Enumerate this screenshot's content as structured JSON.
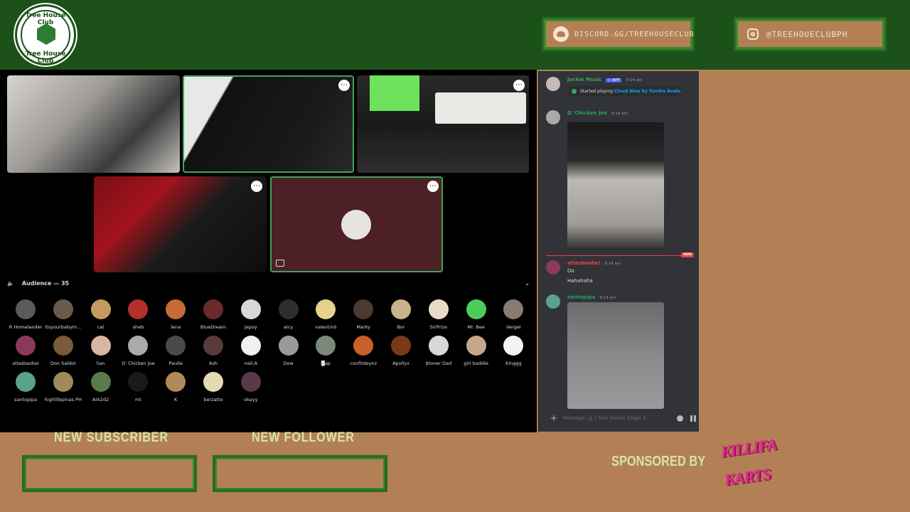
{
  "header": {
    "logo_text_top": "Tree House Club",
    "logo_text_bottom": "Tree House Club",
    "discord_label": "DISCORD.GG/TREEHOUSECLUB",
    "instagram_label": "@TREEHOUECLUBPH"
  },
  "audience": {
    "title": "Audience — 35",
    "members": [
      {
        "name": "R Homelander",
        "color": "#5a5a5a"
      },
      {
        "name": "Itsyourbabym...",
        "color": "#6b5a4a"
      },
      {
        "name": "cat",
        "color": "#c59b5d"
      },
      {
        "name": "sheb",
        "color": "#b1302c"
      },
      {
        "name": "lena",
        "color": "#c66a38"
      },
      {
        "name": "BlueDream",
        "color": "#6b2a2a"
      },
      {
        "name": "Jepoy",
        "color": "#d7d7d7"
      },
      {
        "name": "aicy",
        "color": "#2e2e2e"
      },
      {
        "name": "valentinö",
        "color": "#e7d18c"
      },
      {
        "name": "Marky",
        "color": "#4a3a30"
      },
      {
        "name": "Bor",
        "color": "#c7b48a"
      },
      {
        "name": "SirPrize",
        "color": "#e8dac8"
      },
      {
        "name": "Mr. Bee",
        "color": "#4ccf5a"
      },
      {
        "name": "Vergel",
        "color": "#8a7a70"
      },
      {
        "name": "atlasbaobei",
        "color": "#8a3a5c"
      },
      {
        "name": "Don Saldot",
        "color": "#7a5a3a"
      },
      {
        "name": "lian",
        "color": "#d9b6a0"
      },
      {
        "name": "D' Chicken Joe",
        "color": "#aaaaaa"
      },
      {
        "name": "Paulie",
        "color": "#4a4a4a"
      },
      {
        "name": "Ash",
        "color": "#5a3a3a"
      },
      {
        "name": "neil.A",
        "color": "#f0f0f0"
      },
      {
        "name": "Dew",
        "color": "#9a9a9a"
      },
      {
        "name": "█ap",
        "color": "#7a8a7a"
      },
      {
        "name": "confitdeynz",
        "color": "#c9602a"
      },
      {
        "name": "Apollyx",
        "color": "#7a3a1a"
      },
      {
        "name": "$toner Dad",
        "color": "#d8d8d8"
      },
      {
        "name": "girl baddie",
        "color": "#c4a68a"
      },
      {
        "name": "Kinggg",
        "color": "#f4f4f4"
      },
      {
        "name": "santopipa",
        "color": "#5aa38a"
      },
      {
        "name": "highlifepinas PH",
        "color": "#a08a5a"
      },
      {
        "name": "Ark2d2",
        "color": "#5a7a4a"
      },
      {
        "name": "mt",
        "color": "#1a1a1a"
      },
      {
        "name": "K",
        "color": "#b08a5a"
      },
      {
        "name": "berzatto",
        "color": "#e6d8b0"
      },
      {
        "name": "okayy",
        "color": "#5a3a4a"
      }
    ]
  },
  "chat": {
    "messages": [
      {
        "name": "Jockie Music",
        "name_color": "#3ba55d",
        "badge": "✓ APP",
        "time": "9:14 am",
        "activity_prefix": "Started playing",
        "activity_link": "Cloud Nine by Tundra Beats"
      },
      {
        "name": "D' Chicken Joe",
        "name_color": "#23a55a",
        "time": "9:14 am"
      },
      {
        "name": "atlasbaobei",
        "name_color": "#f23f43",
        "time": "9:14 am",
        "lines": [
          "Oo",
          "Hahahaha"
        ]
      },
      {
        "name": "santopipa",
        "name_color": "#23a55a",
        "time": "9:14 am"
      }
    ],
    "new_label": "NEW",
    "composer_placeholder": "Message 🏕 | Tree House Stage 1"
  },
  "bottom": {
    "subscriber_label": "NEW SUBSCRIBER",
    "follower_label": "NEW FOLLOWER",
    "sponsored_label": "SPONSORED BY",
    "sponsor_logo_text": "KILLIFA KARTS"
  }
}
